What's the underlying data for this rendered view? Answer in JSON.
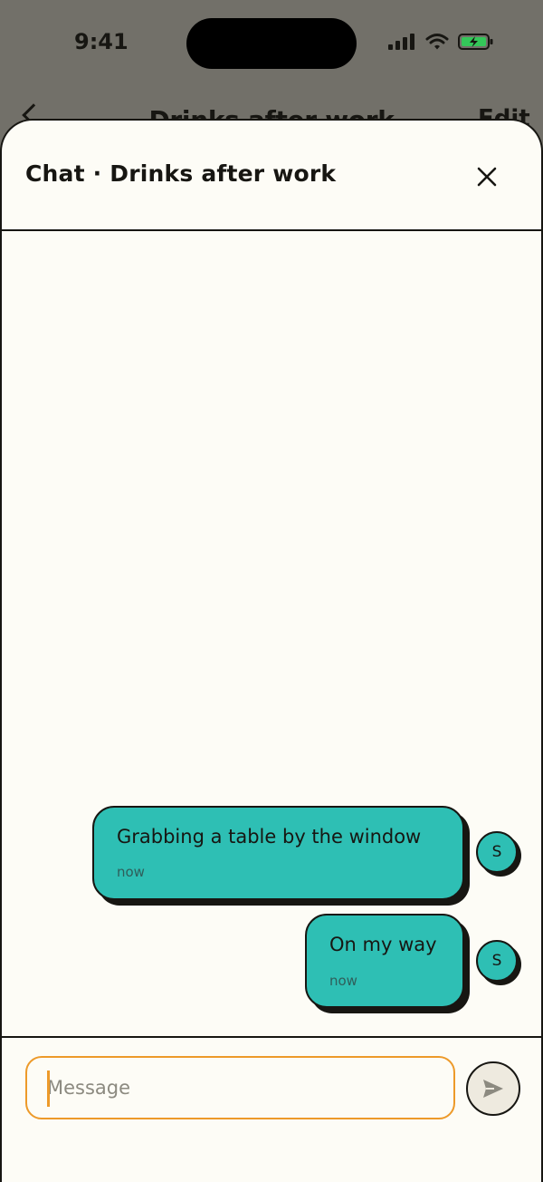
{
  "status_bar": {
    "time": "9:41",
    "icons": [
      "signal-icon",
      "wifi-icon",
      "battery-charging-icon"
    ]
  },
  "background_screen": {
    "title": "Drinks after work",
    "edit_label": "Edit"
  },
  "sheet": {
    "title": "Chat · Drinks after work",
    "close_icon": "close-icon"
  },
  "messages": [
    {
      "text": "Grabbing a table by the window",
      "time": "now",
      "avatar_initial": "S"
    },
    {
      "text": "On my way",
      "time": "now",
      "avatar_initial": "S"
    }
  ],
  "composer": {
    "placeholder": "Message",
    "value": "",
    "send_icon": "send-icon"
  },
  "colors": {
    "bubble": "#2ebfb4",
    "input_focus": "#ed9a2a",
    "sheet_background": "#fdfcf6",
    "ink": "#171612"
  }
}
